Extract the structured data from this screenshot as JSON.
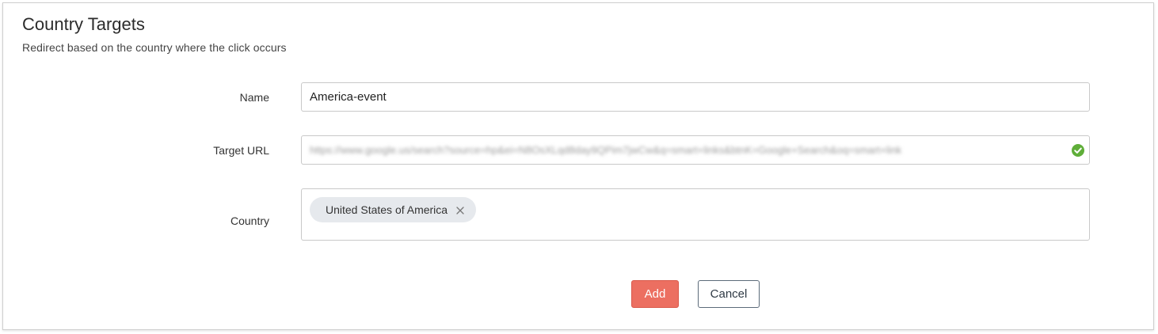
{
  "header": {
    "title": "Country Targets",
    "subtitle": "Redirect based on the country where the click occurs"
  },
  "form": {
    "name_label": "Name",
    "name_value": "America-event",
    "target_url_label": "Target URL",
    "target_url_value": "https://www.google.us/search?source=hp&ei=N8OsXLqd8day9QPim7jwCw&q=smart+links&btnK=Google+Search&oq=smart+link",
    "target_url_status_icon": "check-circle-icon",
    "country_label": "Country",
    "countries": [
      "United States of America"
    ]
  },
  "actions": {
    "add_label": "Add",
    "cancel_label": "Cancel"
  },
  "colors": {
    "primary_button": "#ec6f61",
    "valid_check": "#5fae39",
    "chip_background": "#e6e9ed"
  }
}
